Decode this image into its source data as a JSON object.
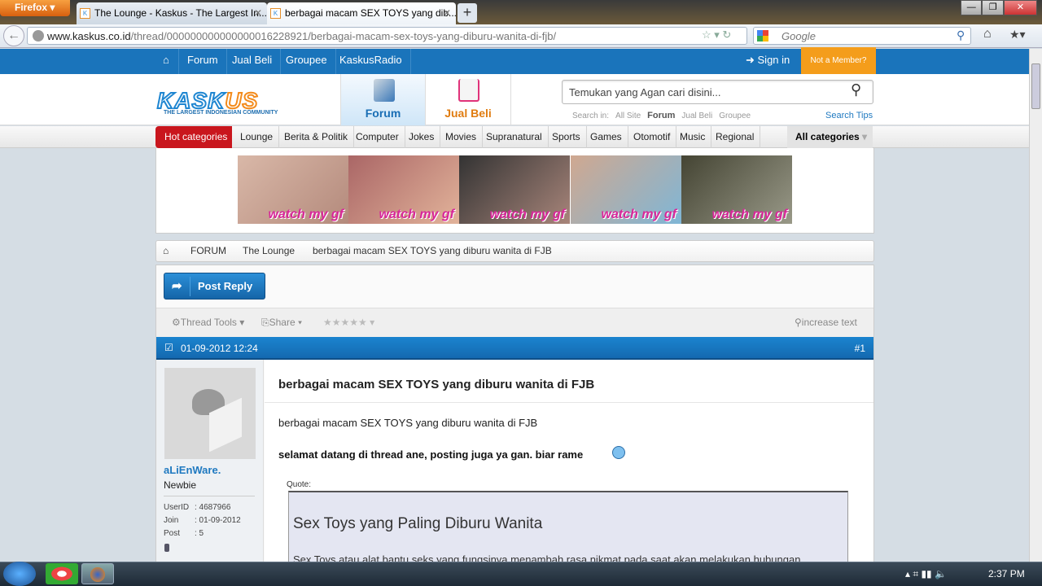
{
  "browser": {
    "menu_label": "Firefox",
    "tabs": [
      {
        "title": "The Lounge - Kaskus - The Largest In..."
      },
      {
        "title": "berbagai macam SEX TOYS yang dib..."
      }
    ],
    "url_domain": "www.kaskus.co.id",
    "url_path": "/thread/000000000000000016228921/berbagai-macam-sex-toys-yang-diburu-wanita-di-fjb/",
    "search_placeholder": "Google"
  },
  "topnav": {
    "items": [
      "Forum",
      "Jual Beli",
      "Groupee",
      "KaskusRadio"
    ],
    "sign_in": "Sign in",
    "not_member": "Not a Member?"
  },
  "header": {
    "logo": "KASKUS",
    "tagline": "THE LARGEST INDONESIAN COMMUNITY",
    "forum_tab": "Forum",
    "jualbeli_tab": "Jual Beli",
    "search_placeholder": "Temukan yang Agan cari disini...",
    "search_in_label": "Search in:",
    "search_scopes": [
      "All Site",
      "Forum",
      "Jual Beli",
      "Groupee"
    ],
    "search_tips": "Search Tips"
  },
  "categories": {
    "hot": "Hot categories",
    "items": [
      "Lounge",
      "Berita & Politik",
      "Computer",
      "Jokes",
      "Movies",
      "Supranatural",
      "Sports",
      "Games",
      "Otomotif",
      "Music",
      "Regional"
    ],
    "all": "All categories"
  },
  "ads": {
    "watermark": "watch my gf"
  },
  "breadcrumb": [
    "FORUM",
    "The Lounge",
    "berbagai macam SEX TOYS yang diburu wanita di FJB"
  ],
  "thread": {
    "post_reply": "Post Reply",
    "thread_tools": "Thread Tools",
    "share": "Share",
    "increase_text": "increase text",
    "rating_stars": 0
  },
  "post": {
    "date": "01-09-2012 12:24",
    "number": "#1",
    "title": "berbagai macam SEX TOYS yang diburu wanita di FJB",
    "line1": "berbagai macam SEX TOYS yang diburu wanita di FJB",
    "line2": "selamat datang di thread ane, posting juga ya gan. biar rame",
    "quote_label": "Quote:",
    "quote_title": "Sex Toys yang Paling Diburu Wanita",
    "quote_text": "Sex Toys atau alat bantu seks yang fungsinya menambah rasa nikmat pada saat akan melakukan hubungan"
  },
  "user": {
    "name": "aLiEnWare.",
    "rank": "Newbie",
    "userid_label": "UserID",
    "userid": ": 4687966",
    "join_label": "Join",
    "join": ": 01-09-2012",
    "post_label": "Post",
    "posts": ": 5"
  },
  "taskbar": {
    "time": "2:37 PM"
  },
  "colors": {
    "brand_blue": "#1a74bb",
    "brand_orange": "#f49d1b",
    "hot_red": "#c9161d"
  }
}
